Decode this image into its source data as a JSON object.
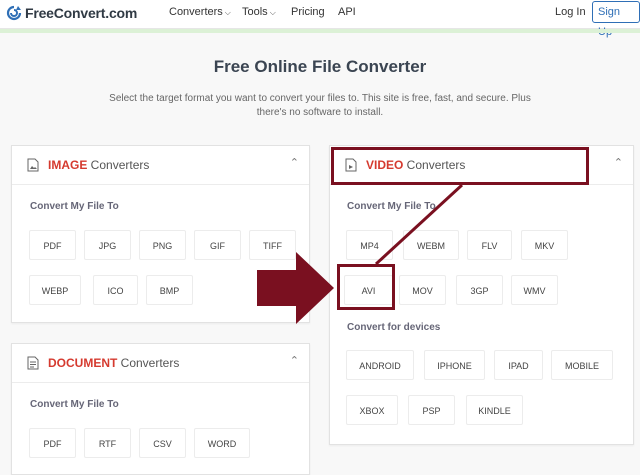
{
  "brand": {
    "name": "FreeConvert.com"
  },
  "nav": {
    "converters": "Converters",
    "tools": "Tools",
    "pricing": "Pricing",
    "api": "API",
    "login": "Log In",
    "signup": "Sign Up"
  },
  "hero": {
    "title": "Free Online File Converter",
    "subtitle": "Select the target format you want to convert your files to. This site is free, fast, and secure. Plus there's no software to install."
  },
  "image_card": {
    "highlight": "IMAGE",
    "rest": " Converters",
    "section": "Convert My File To",
    "formats": [
      "PDF",
      "JPG",
      "PNG",
      "GIF",
      "TIFF",
      "WEBP",
      "ICO",
      "BMP"
    ]
  },
  "video_card": {
    "highlight": "VIDEO",
    "rest": " Converters",
    "section": "Convert My File To",
    "formats": [
      "MP4",
      "WEBM",
      "FLV",
      "MKV",
      "AVI",
      "MOV",
      "3GP",
      "WMV"
    ],
    "devices_label": "Convert for devices",
    "devices": [
      "ANDROID",
      "IPHONE",
      "IPAD",
      "MOBILE",
      "XBOX",
      "PSP",
      "KINDLE"
    ]
  },
  "document_card": {
    "highlight": "DOCUMENT",
    "rest": " Converters",
    "section": "Convert My File To",
    "formats": [
      "PDF",
      "RTF",
      "CSV",
      "WORD"
    ]
  },
  "colors": {
    "accent_red": "#d53a2f",
    "annotation": "#7a1020",
    "link_blue": "#2f6fb6"
  }
}
